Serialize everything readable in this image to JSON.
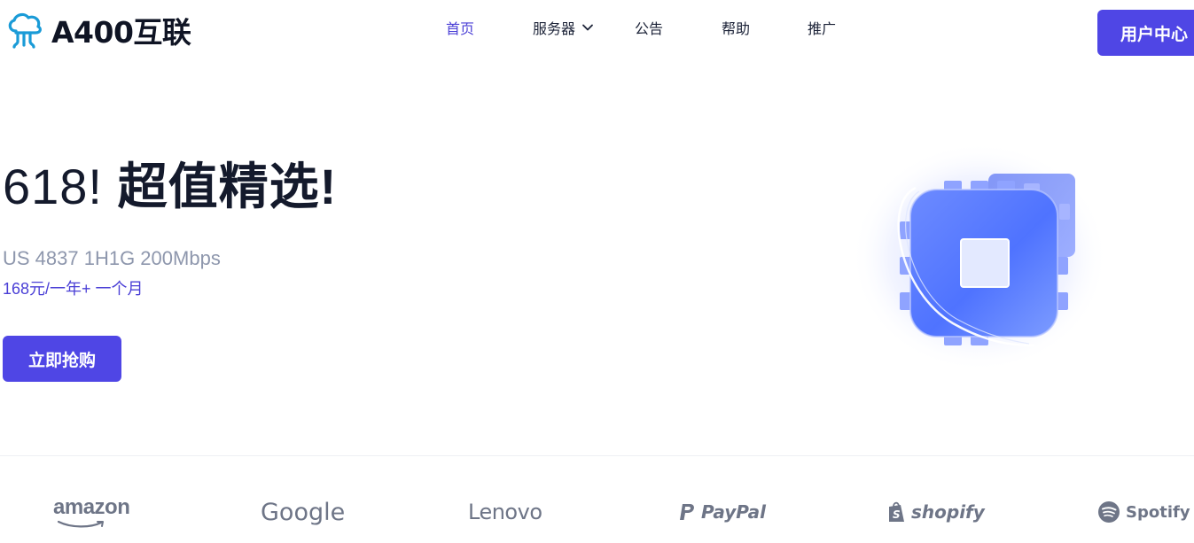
{
  "header": {
    "logo_text": "A400互联",
    "nav": [
      {
        "label": "首页",
        "active": true
      },
      {
        "label": "服务器",
        "has_dropdown": true
      },
      {
        "label": "公告"
      },
      {
        "label": "帮助"
      },
      {
        "label": "推广"
      }
    ],
    "user_center_label": "用户中心"
  },
  "hero": {
    "title_number": "618!",
    "title_text": "超值精选!",
    "spec": "US 4837 1H1G 200Mbps",
    "price": "168元/一年+ 一个月",
    "buy_label": "立即抢购"
  },
  "brands": [
    "amazon",
    "Google",
    "Lenovo",
    "PayPal",
    "shopify",
    "Spotify"
  ],
  "colors": {
    "accent": "#4f46e5",
    "active_nav": "#4a3fd6",
    "muted_text": "#8e97ad",
    "brand_gray": "#6e7587"
  }
}
